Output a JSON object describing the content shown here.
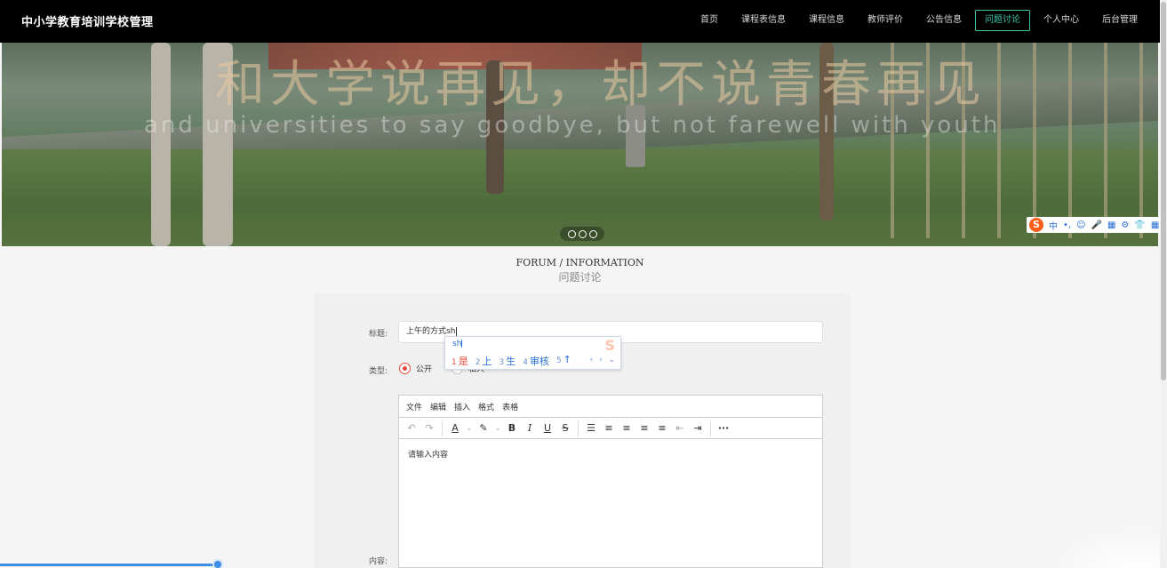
{
  "header": {
    "brand": "中小学教育培训学校管理",
    "nav": [
      {
        "label": "首页",
        "active": false
      },
      {
        "label": "课程表信息",
        "active": false
      },
      {
        "label": "课程信息",
        "active": false
      },
      {
        "label": "教师评价",
        "active": false
      },
      {
        "label": "公告信息",
        "active": false
      },
      {
        "label": "问题讨论",
        "active": true
      },
      {
        "label": "个人中心",
        "active": false
      },
      {
        "label": "后台管理",
        "active": false
      }
    ]
  },
  "banner": {
    "title": "和大学说再见，却不说青春再见",
    "subtitle": "and universities to say goodbye, but not farewell with youth"
  },
  "ime_toolbar": {
    "logo": "S",
    "items": [
      "中",
      "•,",
      "☺",
      "🎤",
      "▦",
      "⚙",
      "👕",
      "▦"
    ]
  },
  "section": {
    "heading_en": "FORUM / INFORMATION",
    "heading_cn": "问题讨论"
  },
  "form": {
    "title_label": "标题:",
    "title_value": "上午的方式sh",
    "type_label": "类型:",
    "type_options": [
      "公开",
      "私人"
    ],
    "type_selected": "公开",
    "content_label": "内容:",
    "editor": {
      "menus": [
        "文件",
        "编辑",
        "插入",
        "格式",
        "表格"
      ],
      "placeholder": "请输入内容",
      "tools": {
        "undo": "↶",
        "redo": "↷",
        "font_color": "A",
        "highlight": "✎",
        "bold": "B",
        "italic": "I",
        "underline": "U",
        "strike": "S",
        "list": "☰",
        "align_left": "≡",
        "align_center": "≡",
        "align_right": "≡",
        "justify": "≡",
        "outdent": "⇤",
        "indent": "⇥",
        "more": "···"
      }
    }
  },
  "ime_popup": {
    "composition": "sh",
    "candidates": [
      {
        "n": "1",
        "text": "是"
      },
      {
        "n": "2",
        "text": "上"
      },
      {
        "n": "3",
        "text": "生"
      },
      {
        "n": "4",
        "text": "审核"
      },
      {
        "n": "5",
        "text": "↑"
      }
    ],
    "nav": "‹ › ⌄"
  },
  "colors": {
    "nav_bg": "#000000",
    "accent": "#3ec9a8",
    "radio_selected": "#e74c3c",
    "ime_blue": "#2a6fd6"
  }
}
